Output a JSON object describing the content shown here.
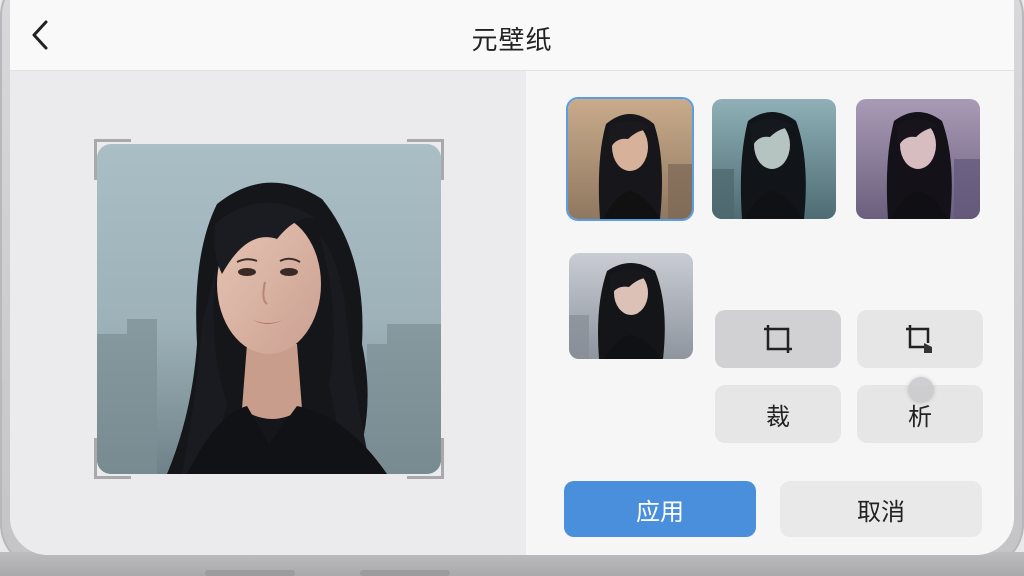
{
  "header": {
    "title": "元壁纸",
    "back_icon": "chevron-left-icon"
  },
  "preview": {
    "image": "portrait-photo"
  },
  "thumbnails": [
    {
      "name": "warm-filter",
      "selected": true
    },
    {
      "name": "teal-filter",
      "selected": false
    },
    {
      "name": "purple-filter",
      "selected": false
    },
    {
      "name": "original",
      "selected": false
    }
  ],
  "tools": {
    "crop_icon": "crop-icon",
    "crop_tap_icon": "crop-tap-icon",
    "cut_label": "裁",
    "analyze_label": "析"
  },
  "actions": {
    "apply_label": "应用",
    "cancel_label": "取消"
  },
  "colors": {
    "accent": "#4a8fdc",
    "selected_outline": "#5b9de0"
  }
}
